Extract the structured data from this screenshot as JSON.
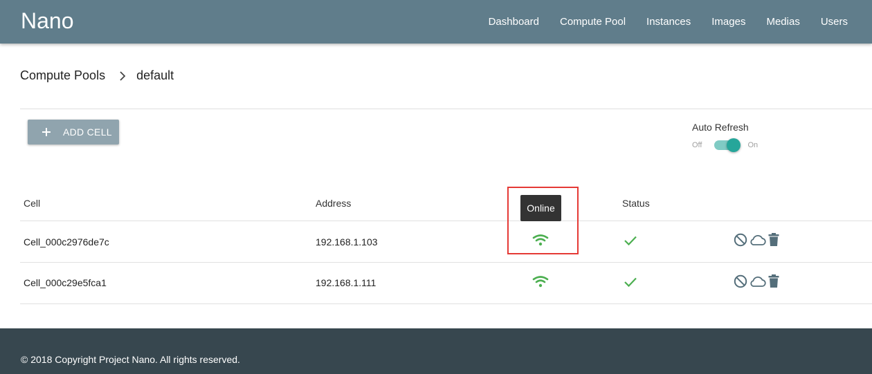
{
  "app": {
    "brand": "Nano"
  },
  "nav": {
    "items": [
      "Dashboard",
      "Compute Pool",
      "Instances",
      "Images",
      "Medias",
      "Users"
    ]
  },
  "breadcrumb": {
    "parent": "Compute Pools",
    "current": "default"
  },
  "toolbar": {
    "add_cell_label": "ADD CELL",
    "plus_icon": "plus-icon"
  },
  "auto_refresh": {
    "title": "Auto Refresh",
    "off_label": "Off",
    "on_label": "On",
    "enabled": true,
    "accent": "#26a69a"
  },
  "table": {
    "headers": {
      "cell": "Cell",
      "address": "Address",
      "status": "Status"
    },
    "rows": [
      {
        "cell": "Cell_000c2976de7c",
        "address": "192.168.1.103",
        "online_icon": "wifi-icon",
        "status_icon": "check-icon",
        "actions": [
          "disable-icon",
          "cloud-icon",
          "trash-icon"
        ]
      },
      {
        "cell": "Cell_000c29e5fca1",
        "address": "192.168.1.111",
        "online_icon": "wifi-icon",
        "status_icon": "check-icon",
        "actions": [
          "disable-icon",
          "cloud-icon",
          "trash-icon"
        ]
      }
    ]
  },
  "tooltip": {
    "text": "Online"
  },
  "colors": {
    "appbar": "#607d8b",
    "online": "#4caf50",
    "footer": "#37474f",
    "highlight": "#e53935"
  },
  "footer": {
    "copyright": "© 2018 Copyright Project Nano. All rights reserved."
  }
}
